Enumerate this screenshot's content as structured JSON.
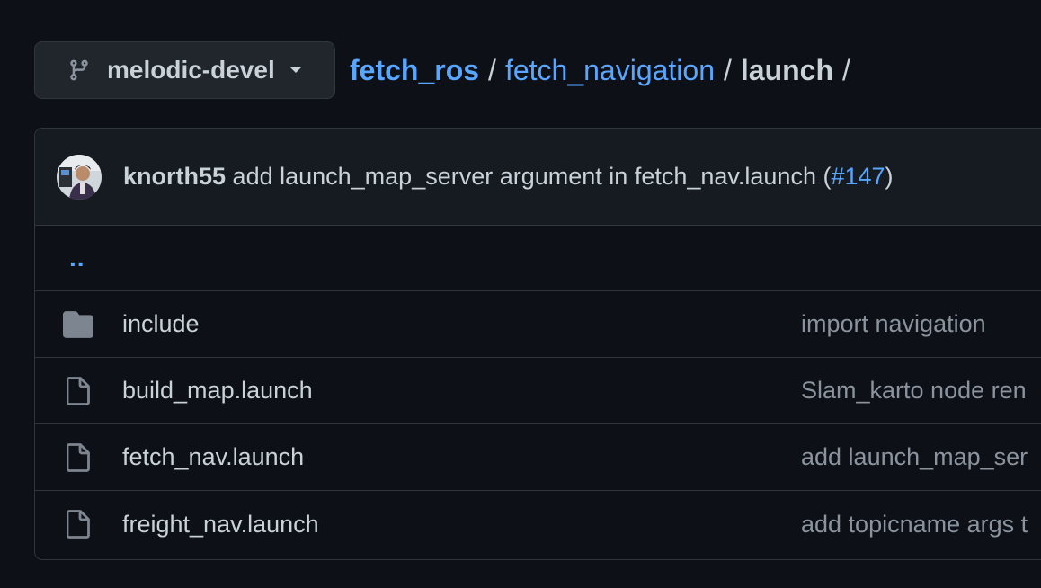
{
  "branch": {
    "name": "melodic-devel",
    "icon": "git-branch-icon"
  },
  "breadcrumb": {
    "repo": "fetch_ros",
    "folder": "fetch_navigation",
    "current": "launch",
    "separator": "/"
  },
  "latest_commit": {
    "author": "knorth55",
    "message": "add launch_map_server argument in fetch_nav.launch (",
    "pr": "#147",
    "close": ")"
  },
  "parent_dir": "..",
  "files": [
    {
      "type": "directory",
      "icon": "folder-icon",
      "name": "include",
      "commit_message": "import navigation"
    },
    {
      "type": "file",
      "icon": "file-icon",
      "name": "build_map.launch",
      "commit_message": "Slam_karto node ren"
    },
    {
      "type": "file",
      "icon": "file-icon",
      "name": "fetch_nav.launch",
      "commit_message": "add launch_map_ser"
    },
    {
      "type": "file",
      "icon": "file-icon",
      "name": "freight_nav.launch",
      "commit_message": "add topicname args t"
    }
  ],
  "colors": {
    "background": "#0d1117",
    "link": "#58a6ff",
    "text": "#c9d1d9",
    "muted": "#8b949e",
    "border": "#30363d"
  }
}
